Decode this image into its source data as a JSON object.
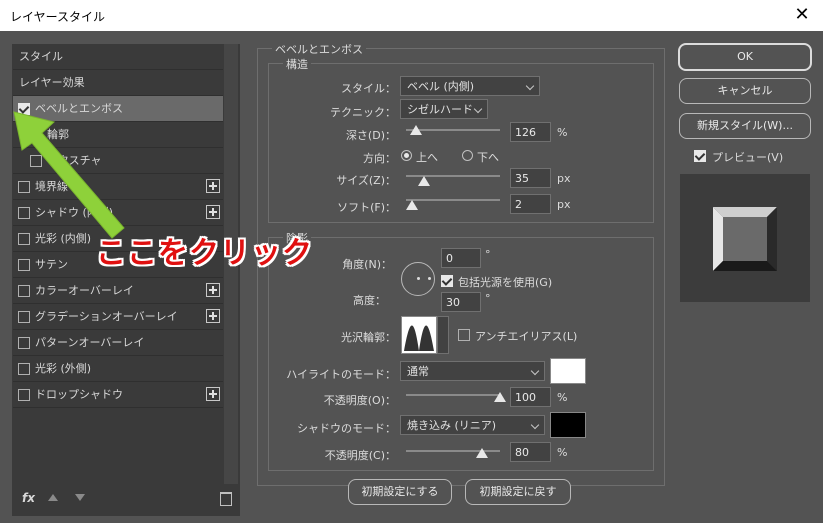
{
  "window": {
    "title": "レイヤースタイル",
    "close": "✕"
  },
  "left": {
    "items": [
      {
        "label": "スタイル"
      },
      {
        "label": "レイヤー効果"
      },
      {
        "label": "ベベルとエンボス"
      },
      {
        "label": "輪郭"
      },
      {
        "label": "テクスチャ"
      },
      {
        "label": "境界線"
      },
      {
        "label": "シャドウ (内側)"
      },
      {
        "label": "光彩 (内側)"
      },
      {
        "label": "サテン"
      },
      {
        "label": "カラーオーバーレイ"
      },
      {
        "label": "グラデーションオーバーレイ"
      },
      {
        "label": "パターンオーバーレイ"
      },
      {
        "label": "光彩 (外側)"
      },
      {
        "label": "ドロップシャドウ"
      }
    ],
    "fx": "fx"
  },
  "bevel": {
    "group_title": "ベベルとエンボス",
    "structure_title": "構造",
    "style_label": "スタイル：",
    "style_value": "ベベル (内側)",
    "technique_label": "テクニック：",
    "technique_value": "シゼルハード",
    "depth_label": "深さ(D)：",
    "depth_value": "126",
    "depth_unit": "%",
    "direction_label": "方向：",
    "dir_up": "上へ",
    "dir_down": "下へ",
    "size_label": "サイズ(Z)：",
    "size_value": "35",
    "size_unit": "px",
    "soften_label": "ソフト(F)：",
    "soften_value": "2",
    "soften_unit": "px"
  },
  "shading": {
    "title": "陰影",
    "angle_label": "角度(N)：",
    "angle_value": "0",
    "degree": "°",
    "global_light": "包括光源を使用(G)",
    "altitude_label": "高度：",
    "altitude_value": "30",
    "gloss_label": "光沢輪郭：",
    "antialias": "アンチエイリアス(L)",
    "highlight_label": "ハイライトのモード：",
    "highlight_mode": "通常",
    "opacity1_label": "不透明度(O)：",
    "opacity1_value": "100",
    "opacity_unit": "%",
    "shadow_label": "シャドウのモード：",
    "shadow_mode": "焼き込み (リニア)",
    "opacity2_label": "不透明度(C)：",
    "opacity2_value": "80",
    "highlight_color": "#ffffff",
    "shadow_color": "#000000"
  },
  "buttons": {
    "make_default": "初期設定にする",
    "reset_default": "初期設定に戻す",
    "ok": "OK",
    "cancel": "キャンセル",
    "new_style": "新規スタイル(W)...",
    "preview": "プレビュー(V)"
  },
  "annotation": {
    "text": "ここをクリック",
    "color": "#e01010",
    "arrow_color": "#8ed13a"
  }
}
